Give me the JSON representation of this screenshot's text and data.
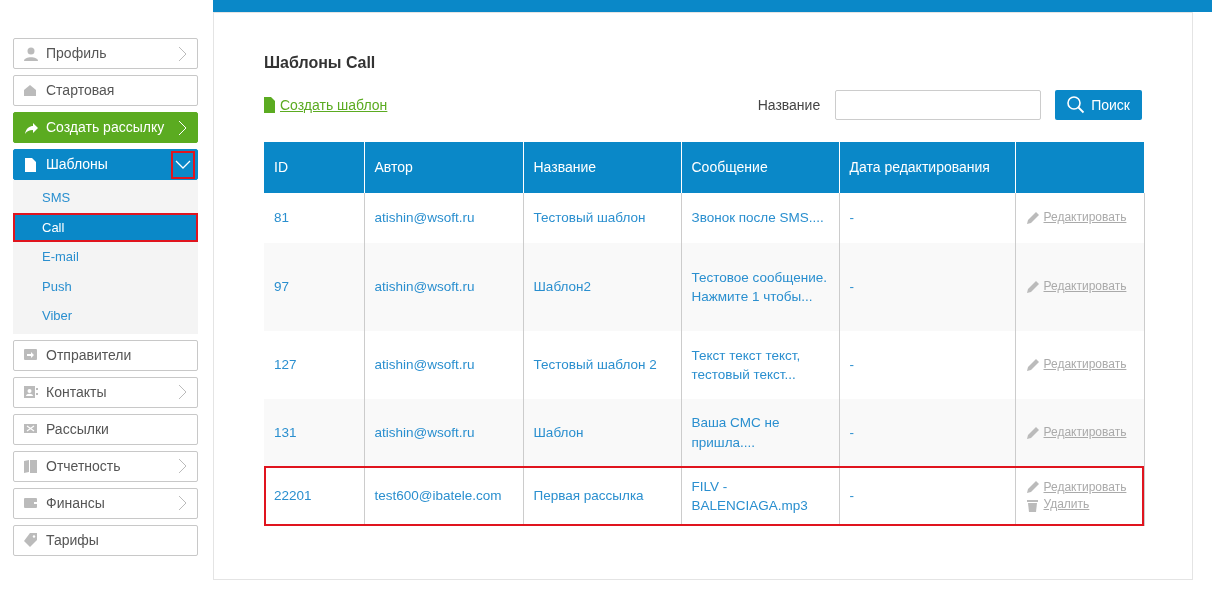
{
  "sidebar": {
    "items": [
      {
        "label": "Профиль",
        "kind": "plain",
        "chevron": true
      },
      {
        "label": "Стартовая",
        "kind": "plain",
        "chevron": false
      },
      {
        "label": "Создать рассылку",
        "kind": "accent",
        "chevron": true
      },
      {
        "label": "Шаблоны",
        "kind": "section",
        "expanded": true,
        "toggle_annotated": true,
        "children": [
          {
            "label": "SMS",
            "selected": false,
            "annotated": false
          },
          {
            "label": "Call",
            "selected": true,
            "annotated": true
          },
          {
            "label": "E-mail",
            "selected": false,
            "annotated": false
          },
          {
            "label": "Push",
            "selected": false,
            "annotated": false
          },
          {
            "label": "Viber",
            "selected": false,
            "annotated": false
          }
        ]
      },
      {
        "label": "Отправители",
        "kind": "plain",
        "chevron": false
      },
      {
        "label": "Контакты",
        "kind": "plain",
        "chevron": true
      },
      {
        "label": "Рассылки",
        "kind": "plain",
        "chevron": false
      },
      {
        "label": "Отчетность",
        "kind": "plain",
        "chevron": true
      },
      {
        "label": "Финансы",
        "kind": "plain",
        "chevron": true
      },
      {
        "label": "Тарифы",
        "kind": "plain",
        "chevron": false
      }
    ]
  },
  "page": {
    "title": "Шаблоны Call",
    "create_link": "Создать шаблон"
  },
  "search": {
    "label": "Название",
    "button": "Поиск"
  },
  "table": {
    "columns": [
      "ID",
      "Автор",
      "Название",
      "Сообщение",
      "Дата редактирования"
    ],
    "rows": [
      {
        "cells": [
          "81",
          "atishin@wsoft.ru",
          "Тестовый шаблон",
          "Звонок после SMS....",
          "-"
        ],
        "annotated": false,
        "actions": [
          {
            "kind": "edit",
            "label": "Редактировать"
          }
        ]
      },
      {
        "cells": [
          "97",
          "atishin@wsoft.ru",
          "Шаблон2",
          "Тестовое сообщение. Нажмите 1 чтобы...",
          "-"
        ],
        "annotated": false,
        "actions": [
          {
            "kind": "edit",
            "label": "Редактировать"
          }
        ]
      },
      {
        "cells": [
          "127",
          "atishin@wsoft.ru",
          "Тестовый шаблон 2",
          "Текст текст текст, тестовый текст...",
          "-"
        ],
        "annotated": false,
        "actions": [
          {
            "kind": "edit",
            "label": "Редактировать"
          }
        ]
      },
      {
        "cells": [
          "131",
          "atishin@wsoft.ru",
          "Шаблон",
          "Ваша СМС не пришла....",
          "-"
        ],
        "annotated": false,
        "actions": [
          {
            "kind": "edit",
            "label": "Редактировать"
          }
        ]
      },
      {
        "cells": [
          "22201",
          "test600@ibatele.com",
          "Первая рассылка",
          "FILV - BALENCIAGA.mp3",
          "-"
        ],
        "annotated": true,
        "actions": [
          {
            "kind": "edit",
            "label": "Редактировать"
          },
          {
            "kind": "delete",
            "label": "Удалить"
          }
        ]
      }
    ]
  }
}
